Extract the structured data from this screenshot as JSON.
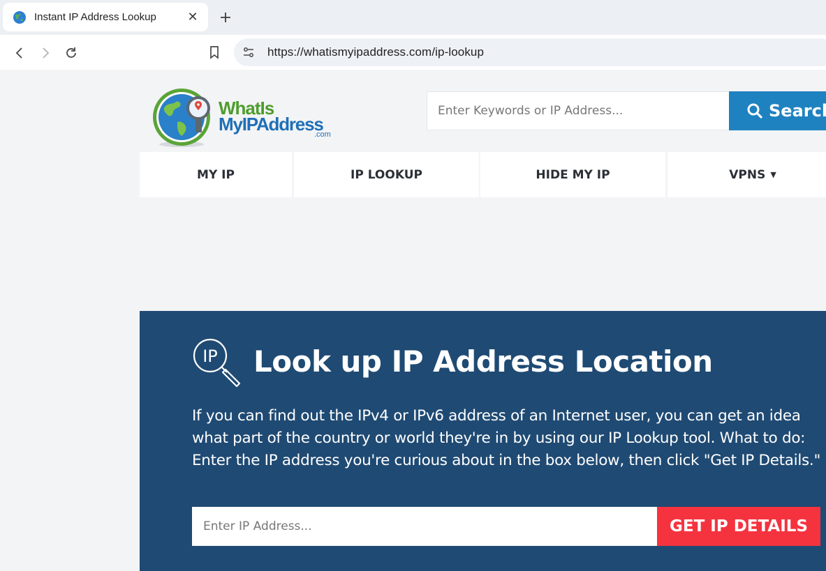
{
  "browser": {
    "tab": {
      "title": "Instant IP Address Lookup",
      "close_glyph": "✕",
      "favicon": "globe-icon"
    },
    "newtab_icon": "plus-icon",
    "url": "https://whatismyipaddress.com/ip-lookup"
  },
  "header": {
    "logo": {
      "line1": "WhatIs",
      "line2": "MyIPAddress",
      "suffix": ".com"
    },
    "search": {
      "placeholder": "Enter Keywords or IP Address...",
      "button_label": "Search"
    }
  },
  "nav": {
    "items": [
      {
        "label": "MY IP"
      },
      {
        "label": "IP LOOKUP"
      },
      {
        "label": "HIDE MY IP"
      },
      {
        "label": "VPNS",
        "caret": "▼"
      }
    ]
  },
  "hero": {
    "icon_text": "IP",
    "title": "Look up IP Address Location",
    "description": "If you can find out the IPv4 or IPv6 address of an Internet user, you can get an idea what part of the country or world they're in by using our IP Lookup tool. What to do: Enter the IP address you're curious about in the box below, then click \"Get IP Details.\"",
    "input_placeholder": "Enter IP Address...",
    "button_label": "GET IP DETAILS"
  },
  "colors": {
    "hero_bg": "#1f4a73",
    "search_button": "#1f82c0",
    "details_button": "#f5333f",
    "logo_green": "#4d9d2c",
    "logo_blue": "#1f6fb6"
  }
}
